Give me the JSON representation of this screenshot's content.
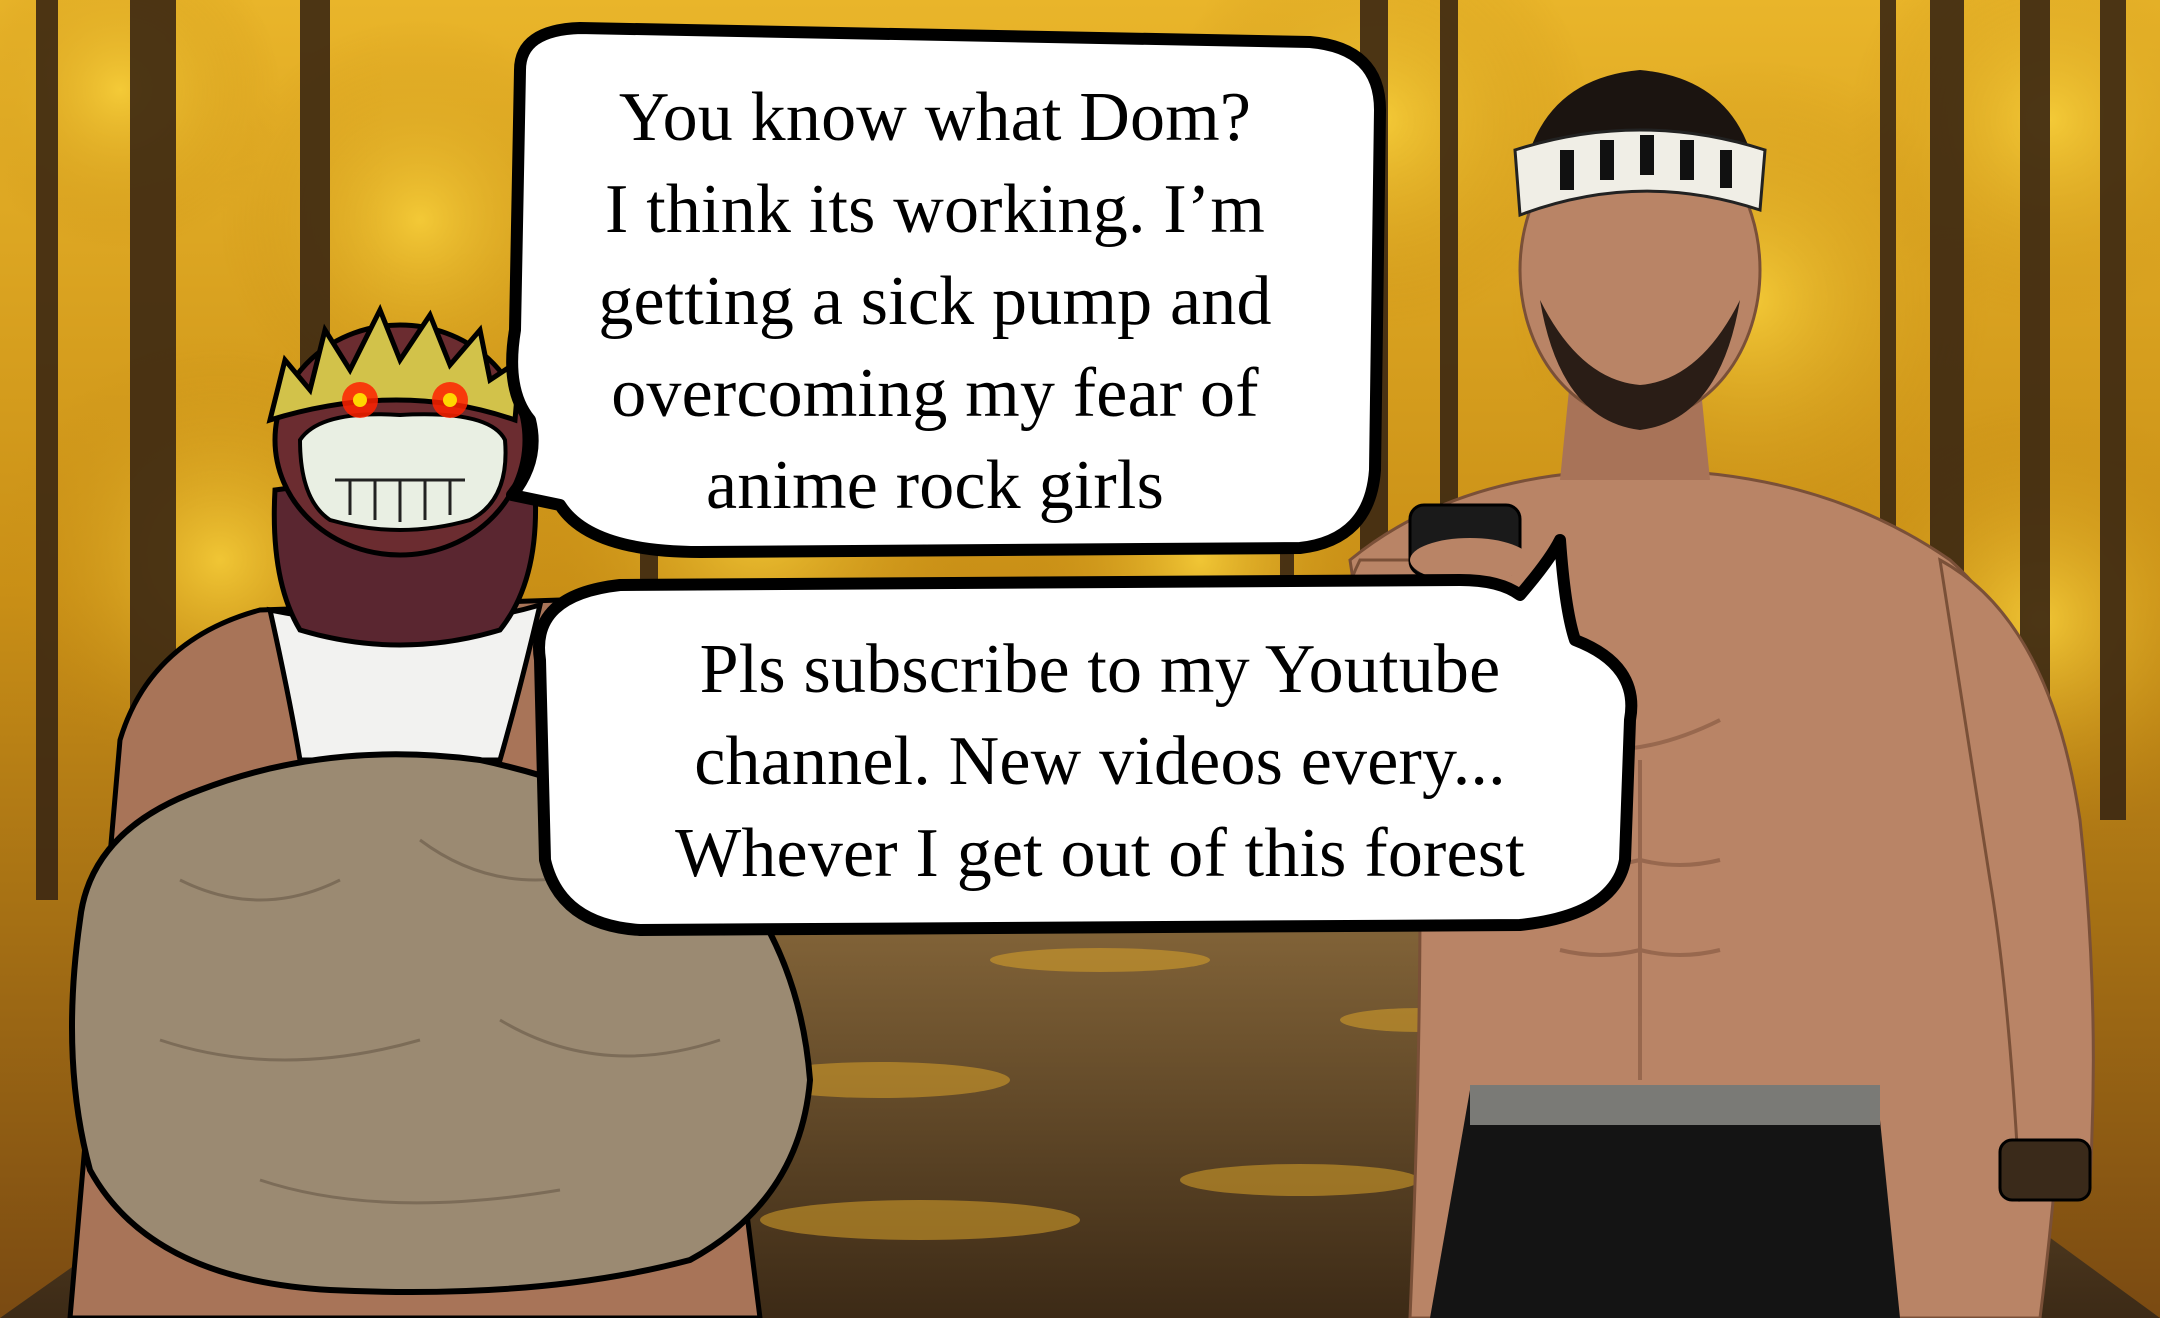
{
  "image": {
    "kind": "meme-comic-panel",
    "setting": "autumn forest path",
    "palette": {
      "foliage": "#d9a418",
      "foliage_dark": "#8a5a0e",
      "trunk": "#3b2712",
      "path": "#5a4226",
      "skin": "#b98466",
      "rock": "#9b8a72",
      "bubble_fill": "#ffffff",
      "bubble_outline": "#000000",
      "glowing_eyes": "#ff2200"
    }
  },
  "characters": {
    "left": {
      "icon": "masked-figure-with-rock",
      "features": [
        "blonde-spiky-hair",
        "red-glowing-eyes",
        "skull-face-mask",
        "maroon-neck-gaiter",
        "white-tank-top",
        "large-boulder"
      ]
    },
    "right": {
      "icon": "shirtless-man-with-phone",
      "features": [
        "headband",
        "beard",
        "smartphone",
        "black-shorts",
        "wristwatch"
      ]
    }
  },
  "bubbles": {
    "first": {
      "speaker": "left",
      "lines": [
        "You know what Dom?",
        "I think its working. I’m",
        "getting a sick pump and",
        "overcoming my fear of",
        "anime rock girls"
      ]
    },
    "second": {
      "speaker": "right",
      "lines": [
        "Pls subscribe to my Youtube",
        "channel. New videos every...",
        "Whever I get out of this forest"
      ]
    }
  }
}
